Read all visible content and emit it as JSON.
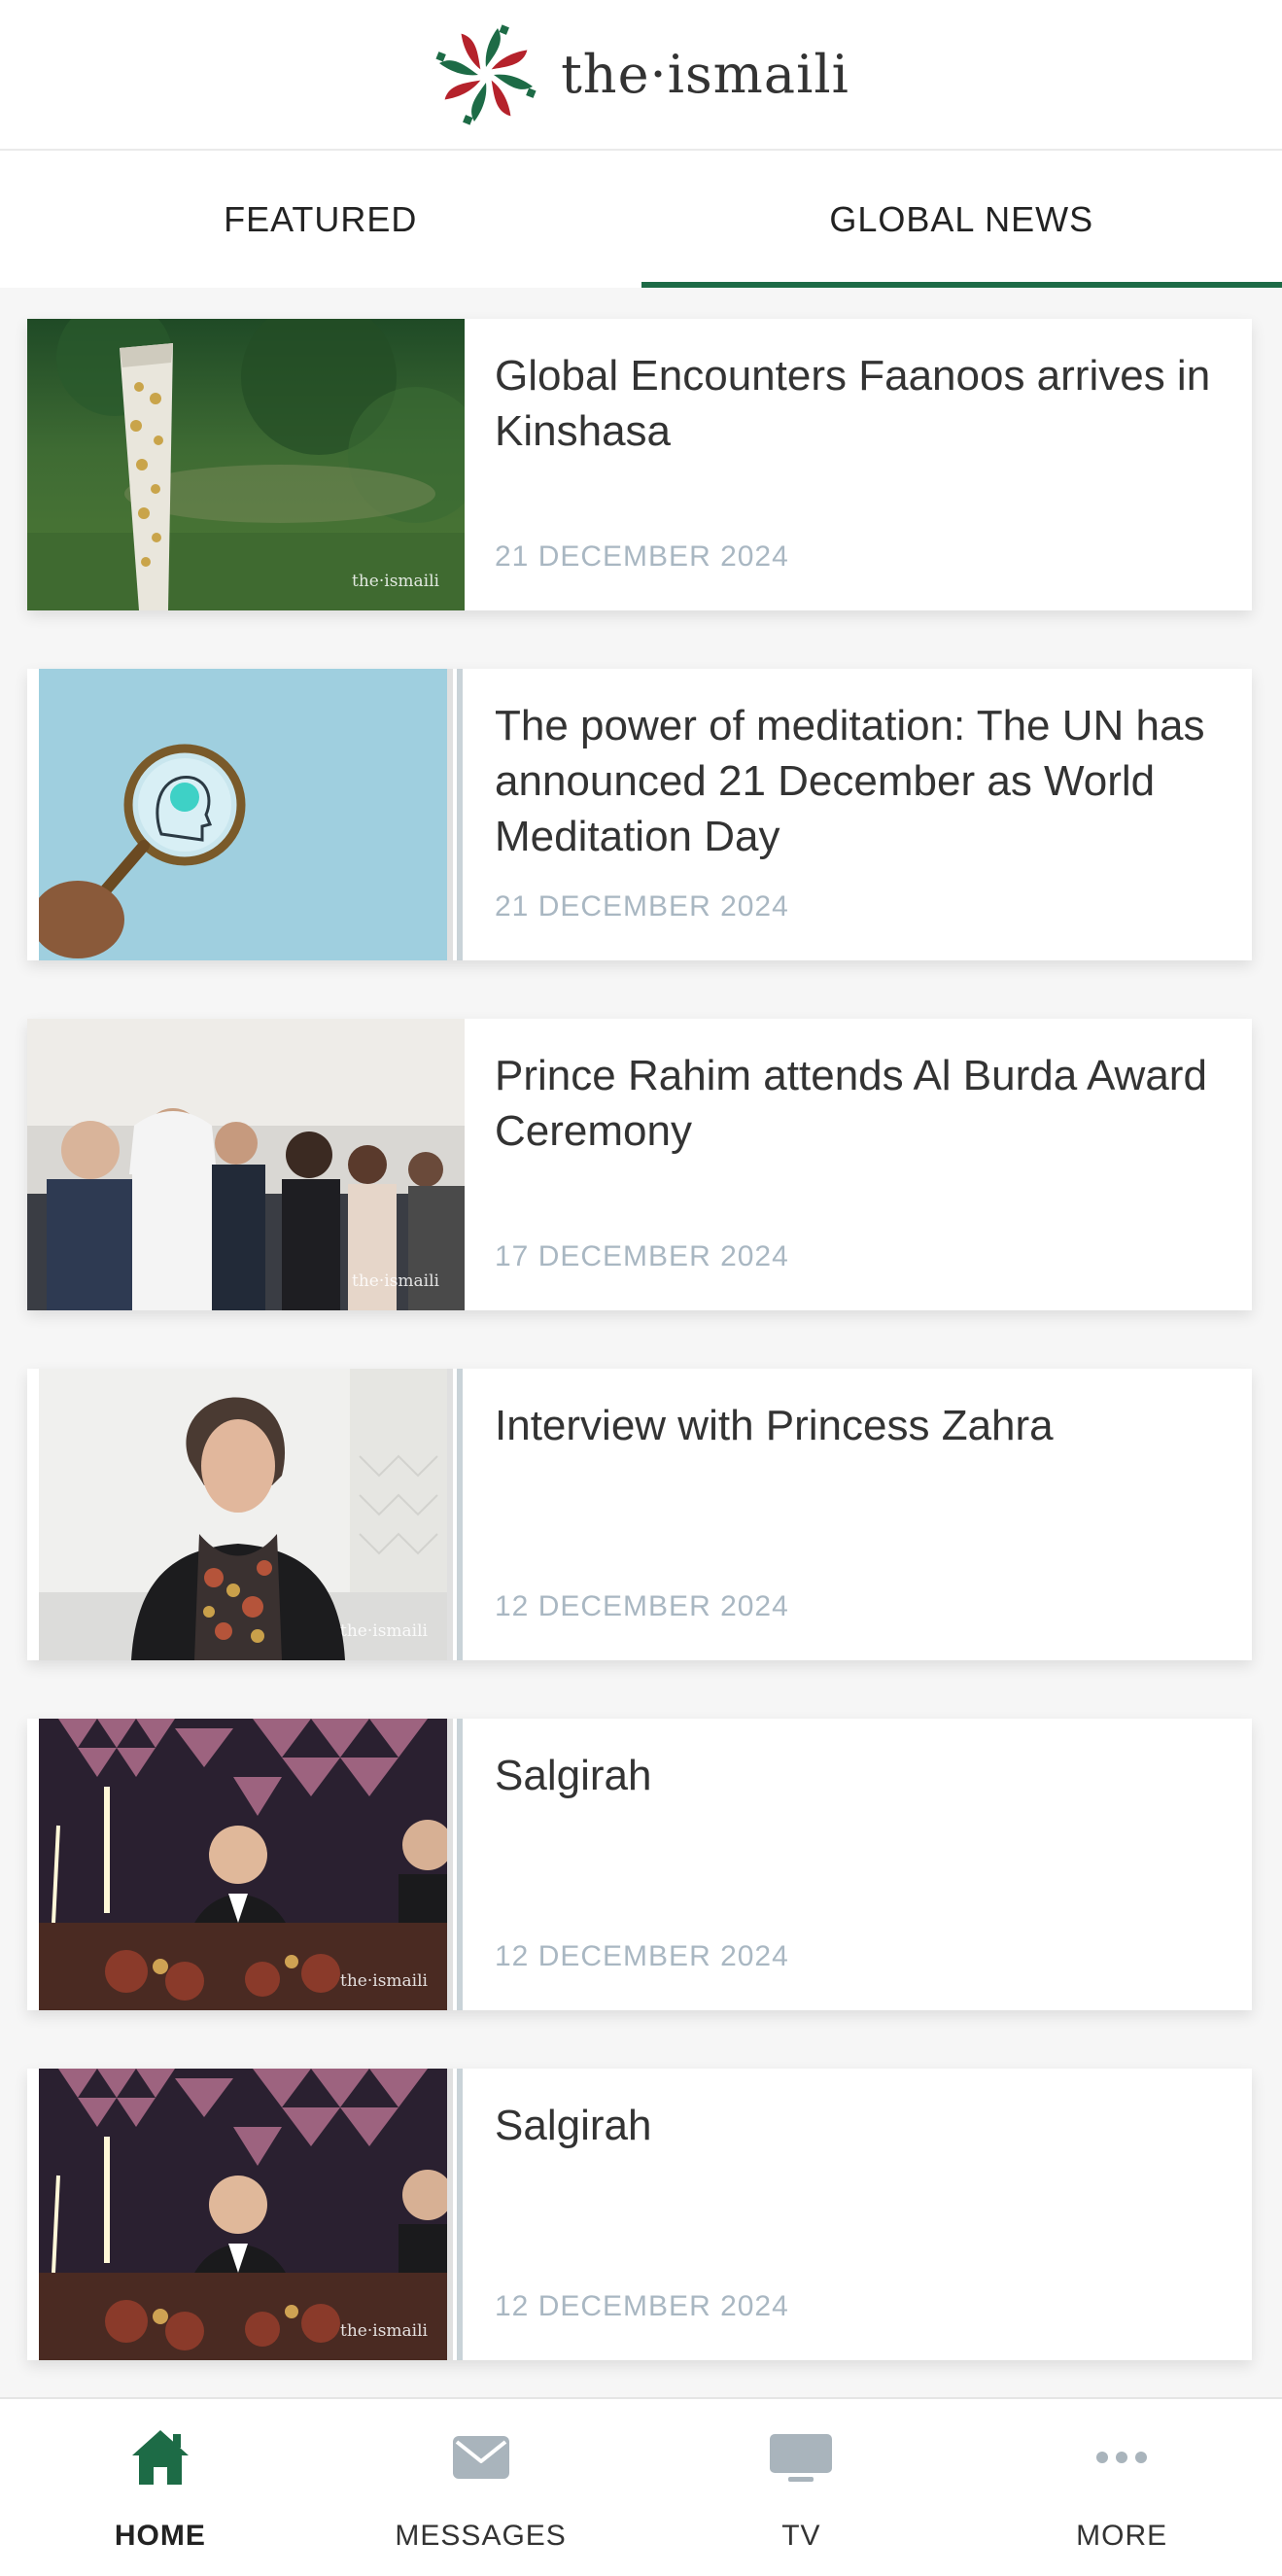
{
  "header": {
    "logo_text": "the·ismaili"
  },
  "tabs": [
    {
      "label": "FEATURED",
      "active": false
    },
    {
      "label": "GLOBAL NEWS",
      "active": true
    }
  ],
  "articles": [
    {
      "title": "Global Encounters Faanoos arrives in Kinshasa",
      "date": "21 DECEMBER 2024",
      "image": "faanoos-torch-photo",
      "watermark": "the·ismaili"
    },
    {
      "title": "The power of meditation: The UN has announced 21 December as World Meditation Day",
      "date": "21 DECEMBER 2024",
      "image": "magnifying-glass-head-photo"
    },
    {
      "title": "Prince Rahim attends Al Burda Award Ceremony",
      "date": "17 DECEMBER 2024",
      "image": "ceremony-audience-photo",
      "watermark": "the·ismaili"
    },
    {
      "title": "Interview with Princess Zahra",
      "date": "12 DECEMBER 2024",
      "image": "princess-portrait-photo",
      "watermark": "the·ismaili"
    },
    {
      "title": "Salgirah",
      "date": "12 DECEMBER 2024",
      "image": "salgirah-celebration-photo",
      "watermark": "the·ismaili"
    },
    {
      "title": "Salgirah",
      "date": "12 DECEMBER 2024",
      "image": "salgirah-celebration-photo",
      "watermark": "the·ismaili"
    }
  ],
  "tabbar": [
    {
      "label": "HOME",
      "icon": "home-icon",
      "active": true
    },
    {
      "label": "MESSAGES",
      "icon": "envelope-icon",
      "active": false
    },
    {
      "label": "TV",
      "icon": "tv-icon",
      "active": false
    },
    {
      "label": "MORE",
      "icon": "more-dots-icon",
      "active": false
    }
  ],
  "colors": {
    "accent": "#1d6b46",
    "date": "#a9b7c2",
    "icon_inactive": "#a9b4bc"
  }
}
